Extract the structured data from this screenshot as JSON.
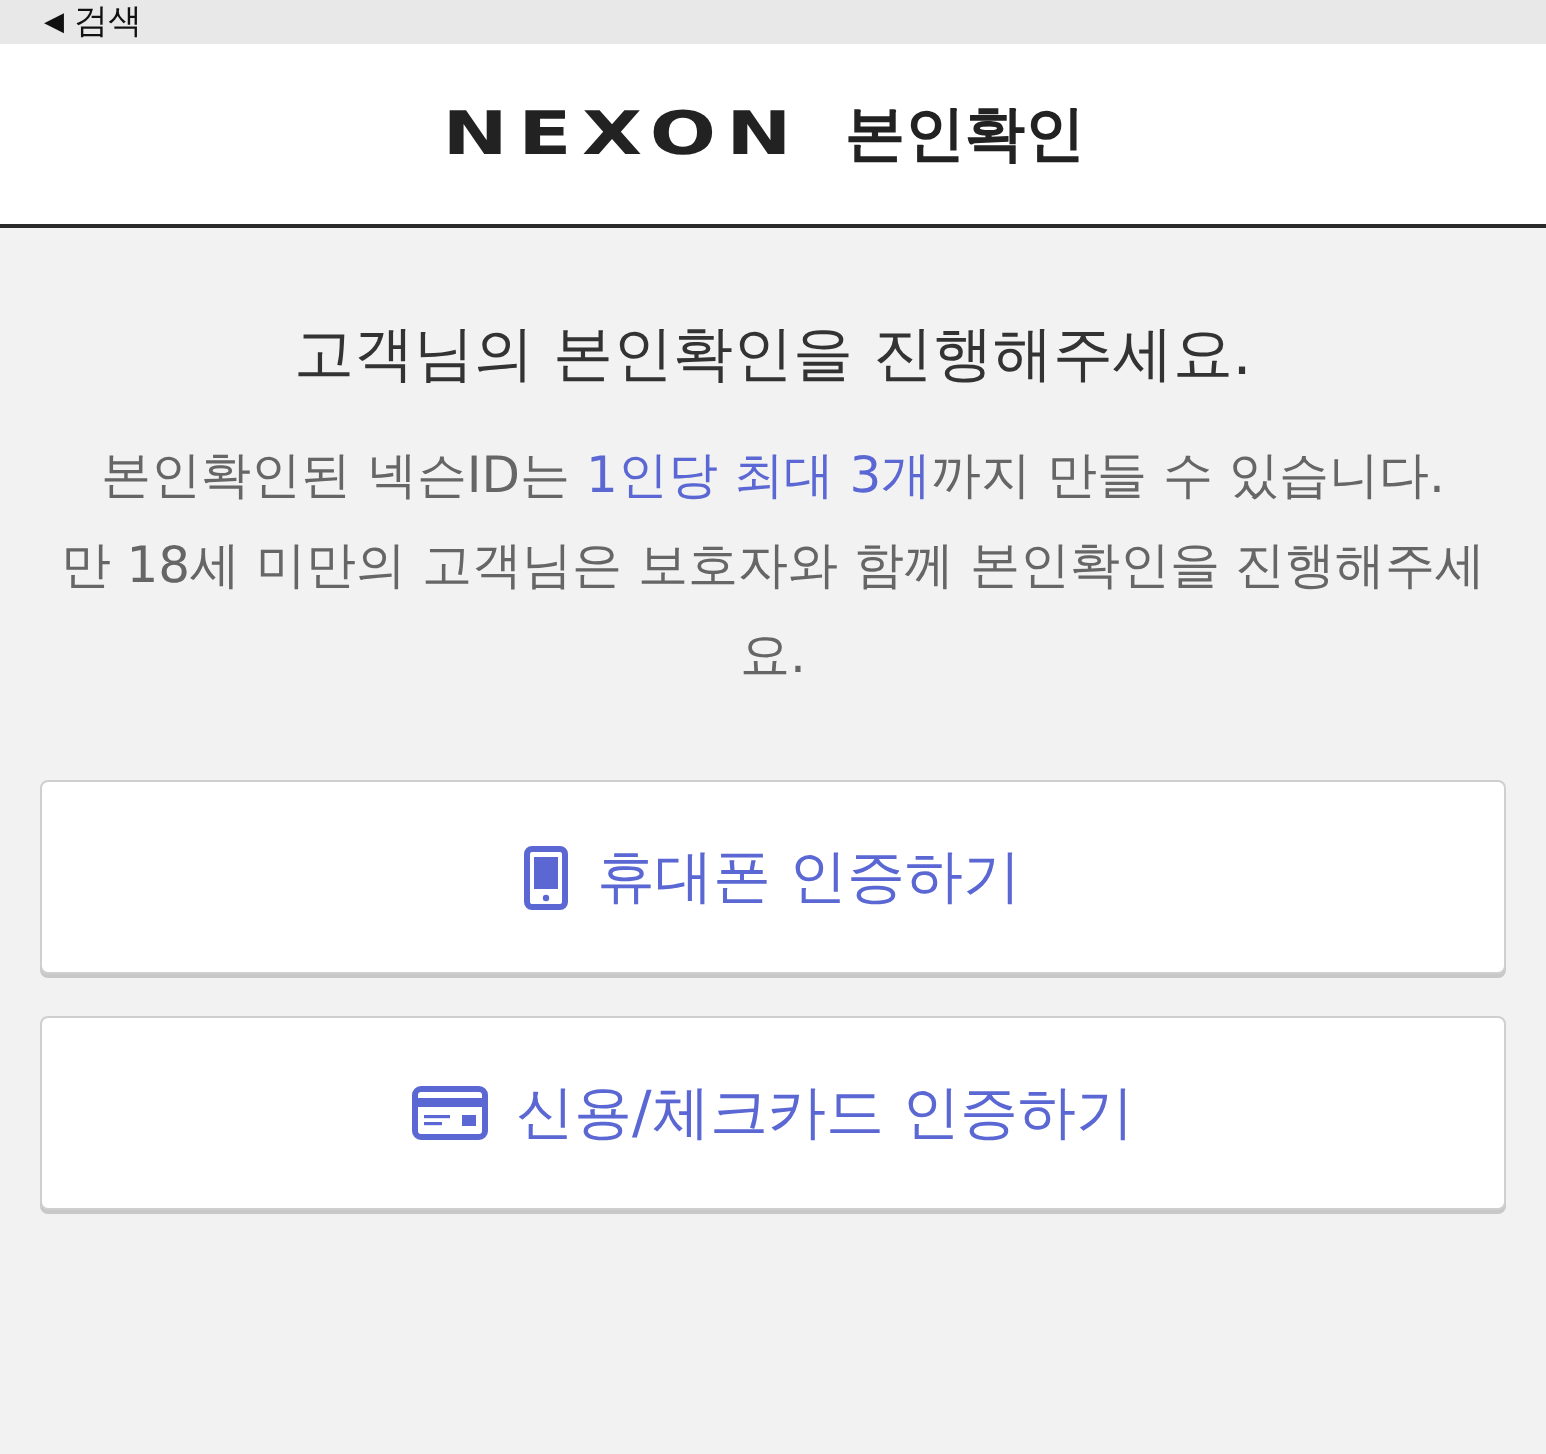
{
  "status_bar": {
    "back_arrow": "◀",
    "back_label": "검색"
  },
  "header": {
    "logo": "NEXON",
    "title": "본인확인"
  },
  "intro": {
    "title": "고객님의 본인확인을 진행해주세요.",
    "notes": [
      {
        "segments": [
          {
            "text": "본인확인된 넥슨ID는 ",
            "highlight": false
          },
          {
            "text": "1인당 최대 3개",
            "highlight": true
          },
          {
            "text": "까지 만들 수 있습니다.",
            "highlight": false
          }
        ]
      },
      {
        "segments": [
          {
            "text": "만 18세 미만의 고객님은 보호자와 함께 본인확인을 진행해주세요.",
            "highlight": false
          }
        ]
      }
    ]
  },
  "buttons": [
    {
      "kind": "phone",
      "label": "휴대폰 인증하기"
    },
    {
      "kind": "card",
      "label": "신용/체크카드 인증하기"
    }
  ]
}
